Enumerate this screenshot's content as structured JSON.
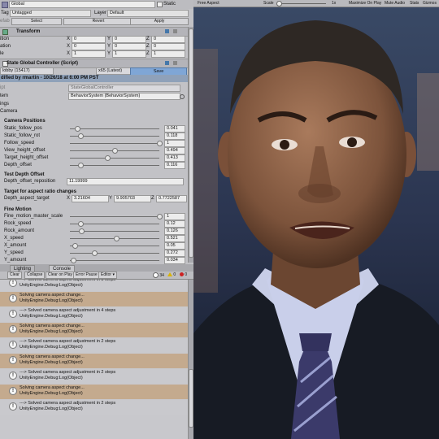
{
  "inspector": {
    "object_name": "Global",
    "static_label": "Static",
    "tag_label": "Tag",
    "tag_value": "Untagged",
    "layer_label": "Layer",
    "layer_value": "Default",
    "prefab_cut": "efab",
    "select_label": "Select",
    "revert_label": "Revert",
    "apply_label": "Apply",
    "transform": {
      "title": "Transform",
      "rows": [
        {
          "label": "ition",
          "x": "0",
          "y": "0",
          "z": "0"
        },
        {
          "label": "ation",
          "x": "0",
          "y": "0",
          "z": "0"
        },
        {
          "label": "le",
          "x": "1",
          "y": "1",
          "z": "1"
        }
      ]
    },
    "component_title": "State Global Controller (Script)",
    "save_row": {
      "left": "lobby (15417)",
      "middle": "x65 (Latest)",
      "save_label": "Save"
    },
    "modified_text": "dified by rmartin - 10/26/18 at 6:00 PM PST",
    "script_row": {
      "label": "ipt",
      "value": "StateGlobalController"
    },
    "system_row": {
      "label": "tem",
      "value": "BehaviorSystem (BehaviorSystem)"
    },
    "cut_labels": [
      "ings",
      "Camera"
    ],
    "camera_positions": {
      "title": "Camera Positions",
      "rows": [
        {
          "label": "Static_follow_pos",
          "value": "0.041",
          "fill": 0.08
        },
        {
          "label": "Static_follow_rot",
          "value": "0.118",
          "fill": 0.12
        },
        {
          "label": "Follow_speed",
          "value": "1",
          "fill": 1.0
        },
        {
          "label": "View_height_offset",
          "value": "0.494",
          "fill": 0.5
        },
        {
          "label": "Target_height_offset",
          "value": "0.413",
          "fill": 0.42
        },
        {
          "label": "Depth_offset",
          "value": "0.116",
          "fill": 0.12
        }
      ]
    },
    "test_depth": {
      "title": "Test Depth Offset",
      "label": "Depth_offset_reposition",
      "value": "11.19999"
    },
    "target_aspect": {
      "title": "Target for aspect ratio changes",
      "label": "Depth_aspect_target",
      "x": "3.21604",
      "y": "9.905703",
      "z": "0.7722587"
    },
    "fine_motion": {
      "title": "Fine Motion",
      "rows": [
        {
          "label": "Fine_motion_master_scale",
          "value": "1",
          "fill": 1.0
        },
        {
          "label": "Rock_speed",
          "value": "0.12",
          "fill": 0.12
        },
        {
          "label": "Rock_amount",
          "value": "0.126",
          "fill": 0.13
        },
        {
          "label": "X_speed",
          "value": "0.521",
          "fill": 0.52
        },
        {
          "label": "X_amount",
          "value": "0.05",
          "fill": 0.05
        },
        {
          "label": "Y_speed",
          "value": "0.272",
          "fill": 0.27
        },
        {
          "label": "Y_amount",
          "value": "0.034",
          "fill": 0.04
        }
      ]
    }
  },
  "console": {
    "tabs": [
      {
        "label": "Lighting"
      },
      {
        "label": "Console"
      }
    ],
    "toolbar": [
      "Clear",
      "Collapse",
      "Clear on Play",
      "Error Pause",
      "Editor ▾"
    ],
    "counts": [
      {
        "icon": "info-icon",
        "value": "34"
      },
      {
        "icon": "warning-icon",
        "value": "0"
      },
      {
        "icon": "error-icon",
        "value": "0"
      }
    ],
    "logs": [
      {
        "line1": "---> Solved camera aspect adjustment in 3 steps",
        "line2": "UnityEngine.Debug:Log(Object)",
        "alt": false
      },
      {
        "line1": "Solving camera aspect change...",
        "line2": "UnityEngine.Debug:Log(Object)",
        "alt": true
      },
      {
        "line1": "---> Solved camera aspect adjustment in 4 steps",
        "line2": "UnityEngine.Debug:Log(Object)",
        "alt": false
      },
      {
        "line1": "Solving camera aspect change...",
        "line2": "UnityEngine.Debug:Log(Object)",
        "alt": true
      },
      {
        "line1": "---> Solved camera aspect adjustment in 2 steps",
        "line2": "UnityEngine.Debug:Log(Object)",
        "alt": false
      },
      {
        "line1": "Solving camera aspect change...",
        "line2": "UnityEngine.Debug:Log(Object)",
        "alt": true
      },
      {
        "line1": "---> Solved camera aspect adjustment in 2 steps",
        "line2": "UnityEngine.Debug:Log(Object)",
        "alt": false
      },
      {
        "line1": "Solving camera aspect change...",
        "line2": "UnityEngine.Debug:Log(Object)",
        "alt": true
      },
      {
        "line1": "---> Solved camera aspect adjustment in 2 steps",
        "line2": "UnityEngine.Debug:Log(Object)",
        "alt": false
      }
    ]
  },
  "game_view": {
    "aspect_label": "Free Aspect",
    "scale_label": "Scale",
    "scale_value": "1x",
    "maximize_label": "Maximize On Play",
    "mute_label": "Mute Audio",
    "stats_label": "Stats",
    "gizmos_label": "Gizmos"
  }
}
